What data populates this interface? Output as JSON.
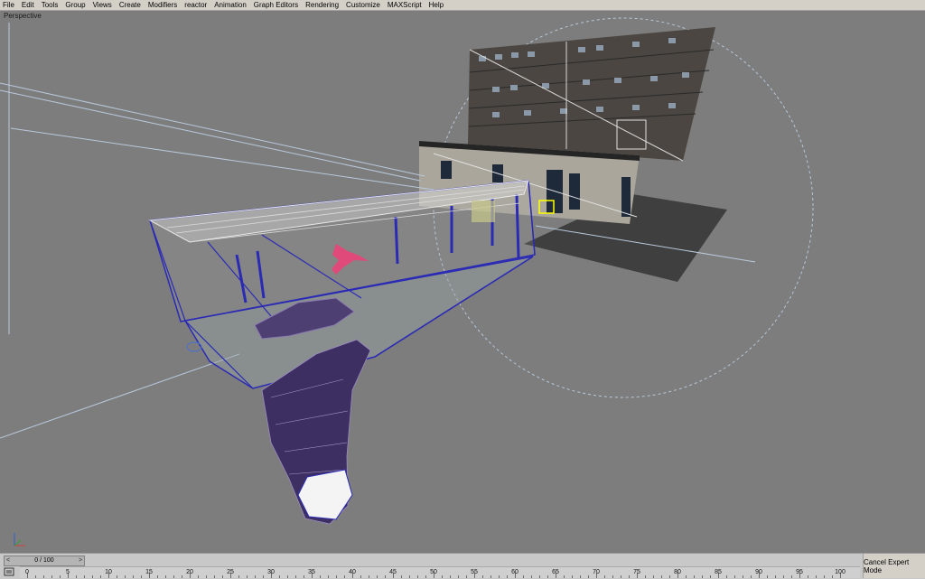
{
  "menu": [
    {
      "label": "File",
      "name": "menu-file"
    },
    {
      "label": "Edit",
      "name": "menu-edit"
    },
    {
      "label": "Tools",
      "name": "menu-tools"
    },
    {
      "label": "Group",
      "name": "menu-group"
    },
    {
      "label": "Views",
      "name": "menu-views"
    },
    {
      "label": "Create",
      "name": "menu-create"
    },
    {
      "label": "Modifiers",
      "name": "menu-modifiers"
    },
    {
      "label": "reactor",
      "name": "menu-reactor"
    },
    {
      "label": "Animation",
      "name": "menu-animation"
    },
    {
      "label": "Graph Editors",
      "name": "menu-graph-editors"
    },
    {
      "label": "Rendering",
      "name": "menu-rendering"
    },
    {
      "label": "Customize",
      "name": "menu-customize"
    },
    {
      "label": "MAXScript",
      "name": "menu-maxscript"
    },
    {
      "label": "Help",
      "name": "menu-help"
    }
  ],
  "viewport": {
    "label": "Perspective"
  },
  "timeline": {
    "frame_label": "0 / 100",
    "left_arrow": "<",
    "right_arrow": ">",
    "ticks": [
      "0",
      "5",
      "10",
      "15",
      "20",
      "25",
      "30",
      "35",
      "40",
      "45",
      "50",
      "55",
      "60",
      "65",
      "70",
      "75",
      "80",
      "85",
      "90",
      "95",
      "100"
    ]
  },
  "status": {
    "expert_button": "Cancel Expert Mode"
  },
  "icons": {
    "axis": "axis-tripod-icon",
    "track": "track-view-icon"
  },
  "colors": {
    "viewport_bg": "#7d7d7d",
    "wire_blue": "#2a2ab5",
    "wire_white": "#e8e8e8",
    "selected": "#ffff00"
  }
}
